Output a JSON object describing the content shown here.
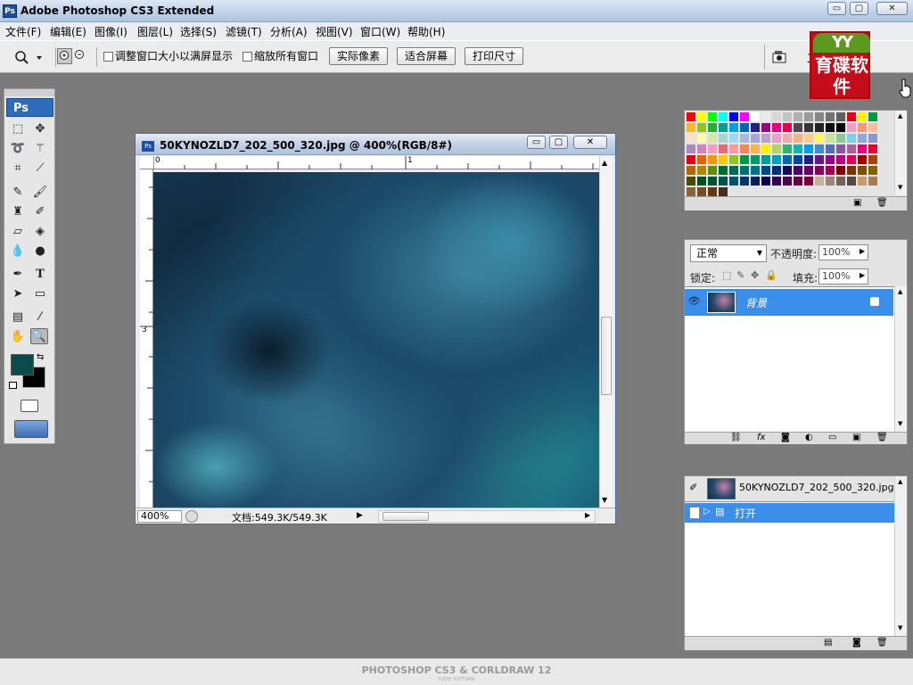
{
  "app": {
    "title": "Adobe Photoshop CS3 Extended",
    "icon_text": "Ps"
  },
  "window_buttons": {
    "minimize": "▭",
    "maximize": "▢",
    "close": "✕"
  },
  "menubar": {
    "items": [
      "文件(F)",
      "编辑(E)",
      "图像(I)",
      "图层(L)",
      "选择(S)",
      "滤镜(T)",
      "分析(A)",
      "视图(V)",
      "窗口(W)",
      "帮助(H)"
    ]
  },
  "options_bar": {
    "tool_icon": "magnifier-icon",
    "zoom_in_icon": "zoom-in-icon",
    "zoom_out_icon": "zoom-out-icon",
    "resize_windows_label": "调整窗口大小以满屏显示",
    "zoom_all_windows_label": "缩放所有窗口",
    "resize_windows_checked": false,
    "zoom_all_windows_checked": false,
    "actual_pixels_label": "实际像素",
    "fit_screen_label": "适合屏幕",
    "print_size_label": "打印尺寸",
    "workspace_label": "工"
  },
  "logo": {
    "top": "YY",
    "text": "育碟软件"
  },
  "toolbox": {
    "ps_label": "Ps",
    "foreground_color": "#0a4c4b",
    "background_color": "#000000"
  },
  "document": {
    "title": "50KYNOZLD7_202_500_320.jpg @ 400%(RGB/8#)",
    "icon_text": "Ps",
    "ruler_h_labels": [
      "0",
      "1"
    ],
    "ruler_v_labels": [
      "3"
    ],
    "zoom_value": "400%",
    "doc_info": "文档:549.3K/549.3K"
  },
  "swatches": {
    "colors": [
      "#ff0000",
      "#ffff00",
      "#00ff00",
      "#00ffff",
      "#0000ff",
      "#ff00ff",
      "#ffffff",
      "#ebebeb",
      "#d7d7d7",
      "#c3c3c3",
      "#afafaf",
      "#9b9b9b",
      "#878787",
      "#737373",
      "#5f5f5f",
      "#e60012",
      "#fff100",
      "#009944",
      "#f8b62b",
      "#8fc31f",
      "#22ac38",
      "#009e96",
      "#00a0e9",
      "#0068b7",
      "#1d2088",
      "#920783",
      "#e4007f",
      "#e5004f",
      "#4b4b4b",
      "#373737",
      "#232323",
      "#0f0f0f",
      "#000000",
      "#f19ec2",
      "#f29b76",
      "#fabe9a",
      "#fce2c4",
      "#fff9b1",
      "#d2e7aa",
      "#a3d6cc",
      "#a0d8ef",
      "#a5b8de",
      "#a7a6d3",
      "#b8a0cf",
      "#e7a3c7",
      "#f3a9b0",
      "#f6b37f",
      "#facd89",
      "#fff45c",
      "#cce198",
      "#89c997",
      "#7ecef4",
      "#8fa8d6",
      "#8c97cb",
      "#aa89bd",
      "#cd86b5",
      "#f19ec2",
      "#eb6877",
      "#f29c9f",
      "#ee8755",
      "#f7b552",
      "#fff100",
      "#b3d465",
      "#32b16c",
      "#13b5b1",
      "#00a0e9",
      "#448aca",
      "#556fb5",
      "#8957a1",
      "#ae5da1",
      "#e4007f",
      "#e60033",
      "#e60012",
      "#eb6100",
      "#f39800",
      "#fcc800",
      "#8fc31f",
      "#009944",
      "#009b6b",
      "#009e96",
      "#00a0c1",
      "#0068b7",
      "#00479d",
      "#1d2088",
      "#601986",
      "#920783",
      "#be0081",
      "#e5004f",
      "#a40000",
      "#a84200",
      "#ac6a00",
      "#b28500",
      "#638c0b",
      "#006d2f",
      "#006e4e",
      "#007072",
      "#00738e",
      "#004986",
      "#002e73",
      "#100964",
      "#440062",
      "#6a005f",
      "#86005e",
      "#a4004f",
      "#7d0000",
      "#7e2f00",
      "#7f4f00",
      "#836300",
      "#474a00",
      "#005222",
      "#005239",
      "#005355",
      "#005467",
      "#003565",
      "#002157",
      "#0c004e",
      "#33004b",
      "#500048",
      "#650042",
      "#7d0038",
      "#c7b299",
      "#998675",
      "#736357",
      "#534741",
      "#c69c6d",
      "#a67c52",
      "#8c6239",
      "#754c24",
      "#603913",
      "#462c1a"
    ]
  },
  "layers": {
    "blend_mode": "正常",
    "opacity_label": "不透明度:",
    "opacity_value": "100%",
    "lock_label": "锁定:",
    "fill_label": "填充:",
    "fill_value": "100%",
    "layer_name": "背景"
  },
  "history": {
    "snapshot_name": "50KYNOZLD7_202_500_320.jpg",
    "step_label": "打开"
  },
  "footer": {
    "text": "PHOTOSHOP CS3 & CORLDRAW 12",
    "sub": "YUDIE SOFTWAR"
  }
}
